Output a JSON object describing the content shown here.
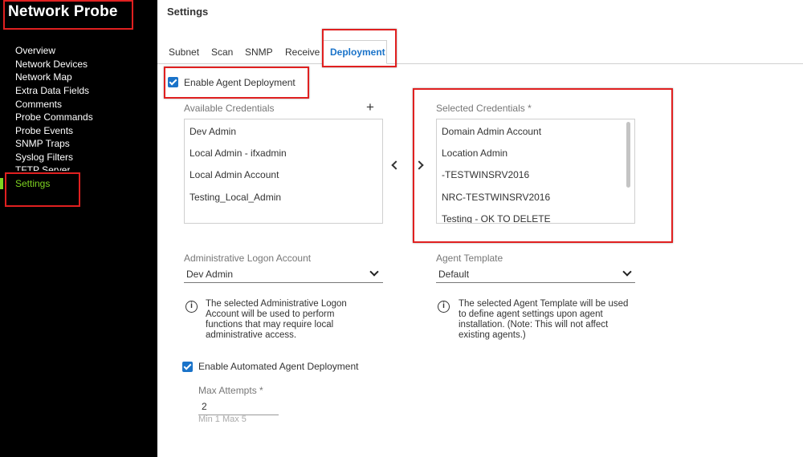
{
  "sidebar": {
    "title": "Network Probe",
    "items": [
      {
        "label": "Overview"
      },
      {
        "label": "Network Devices"
      },
      {
        "label": "Network Map"
      },
      {
        "label": "Extra Data Fields"
      },
      {
        "label": "Comments"
      },
      {
        "label": "Probe Commands"
      },
      {
        "label": "Probe Events"
      },
      {
        "label": "SNMP Traps"
      },
      {
        "label": "Syslog Filters"
      },
      {
        "label": "TFTP Server"
      },
      {
        "label": "Settings"
      }
    ],
    "active_item": "Settings"
  },
  "header": {
    "title": "Settings"
  },
  "tabs": [
    {
      "label": "Subnet"
    },
    {
      "label": "Scan"
    },
    {
      "label": "SNMP"
    },
    {
      "label": "Receive"
    },
    {
      "label": "Deployment"
    }
  ],
  "active_tab": "Deployment",
  "deployment": {
    "enable_agent_label": "Enable Agent Deployment",
    "enable_agent_checked": true,
    "available_label": "Available Credentials",
    "add_icon_glyph": "+",
    "available": [
      "Dev Admin",
      "Local Admin - ifxadmin",
      "Local Admin Account",
      "Testing_Local_Admin"
    ],
    "selected_label": "Selected Credentials *",
    "selected": [
      "Domain Admin Account",
      "Location Admin",
      "-TESTWINSRV2016",
      "NRC-TESTWINSRV2016",
      "Testing - OK TO DELETE"
    ],
    "admin_logon_label": "Administrative Logon Account",
    "admin_logon_value": "Dev Admin",
    "admin_logon_info": "The selected Administrative Logon Account will be used to perform functions that may require local administrative access.",
    "template_label": "Agent Template",
    "template_value": "Default",
    "template_info": "The selected Agent Template will be used to define agent settings upon agent installation. (Note: This will not affect existing agents.)",
    "info_glyph": "i",
    "auto_label": "Enable Automated Agent Deployment",
    "auto_checked": true,
    "max_attempts_label": "Max Attempts *",
    "max_attempts_value": "2",
    "max_attempts_hint": "Min 1 Max 5"
  },
  "colors": {
    "accent": "#1a73c9",
    "active_nav": "#7ed321",
    "highlight": "#e02020",
    "sidebar_bg": "#000000"
  }
}
